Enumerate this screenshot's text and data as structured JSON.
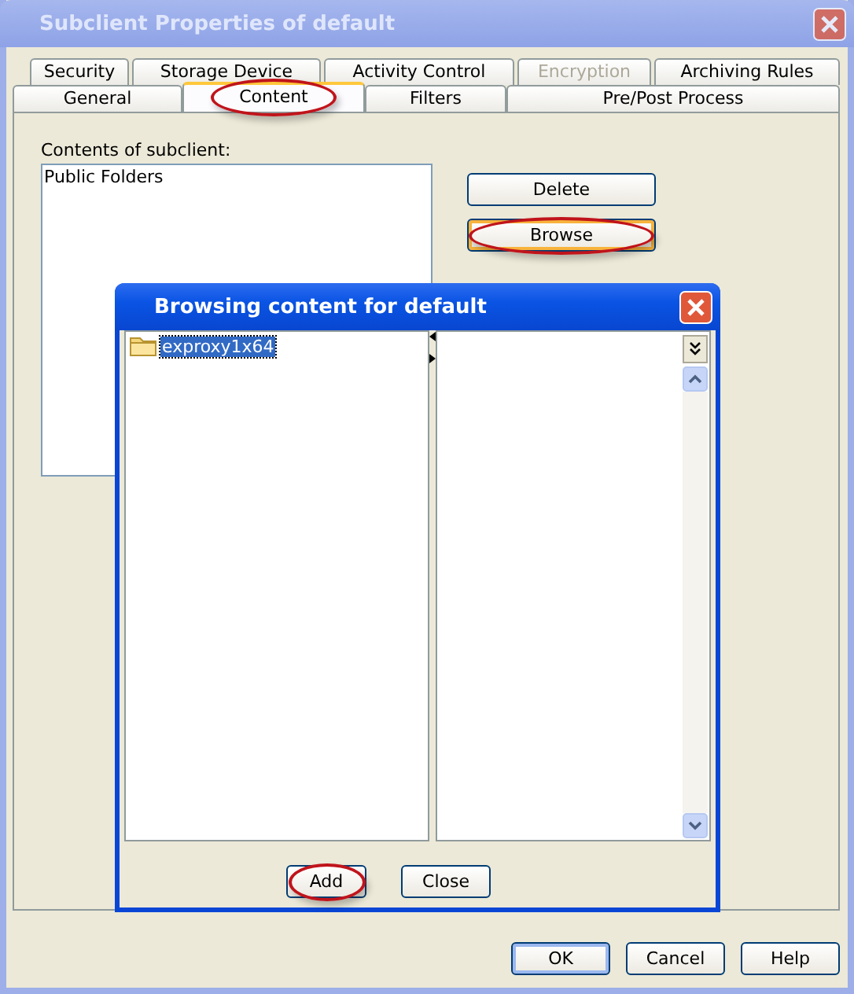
{
  "window": {
    "title": "Subclient Properties of default",
    "active": false
  },
  "tab_rows": [
    [
      {
        "label": "Security",
        "selected": false,
        "disabled": false,
        "highlighted": false
      },
      {
        "label": "Storage Device",
        "selected": false,
        "disabled": false,
        "highlighted": false
      },
      {
        "label": "Activity Control",
        "selected": false,
        "disabled": false,
        "highlighted": false
      },
      {
        "label": "Encryption",
        "selected": false,
        "disabled": true,
        "highlighted": false
      },
      {
        "label": "Archiving Rules",
        "selected": false,
        "disabled": false,
        "highlighted": false
      }
    ],
    [
      {
        "label": "General",
        "selected": false,
        "disabled": false,
        "highlighted": false
      },
      {
        "label": "Content",
        "selected": true,
        "disabled": false,
        "highlighted": true
      },
      {
        "label": "Filters",
        "selected": false,
        "disabled": false,
        "highlighted": false
      },
      {
        "label": "Pre/Post Process",
        "selected": false,
        "disabled": false,
        "highlighted": false
      }
    ]
  ],
  "content": {
    "label": "Contents of subclient:",
    "items": [
      "Public Folders"
    ],
    "buttons": [
      {
        "label": "Delete",
        "focused": false,
        "highlighted": false
      },
      {
        "label": "Browse",
        "focused": true,
        "highlighted": true
      }
    ]
  },
  "browse_dialog": {
    "title": "Browsing content for default",
    "active": true,
    "tree": [
      {
        "label": "exproxy1x64",
        "selected": true
      }
    ],
    "buttons": [
      {
        "label": "Add",
        "focused": false,
        "highlighted": true
      },
      {
        "label": "Close",
        "focused": false,
        "highlighted": false
      }
    ]
  },
  "buttons": [
    {
      "label": "OK",
      "focused": true
    },
    {
      "label": "Cancel",
      "focused": false
    },
    {
      "label": "Help",
      "focused": false
    }
  ]
}
